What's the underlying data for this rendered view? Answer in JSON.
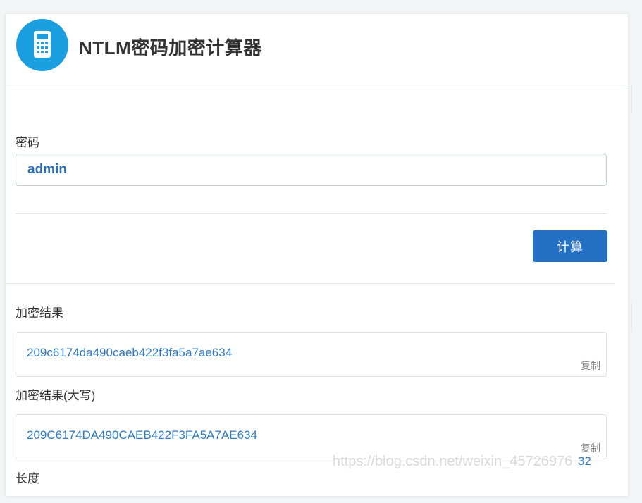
{
  "header": {
    "title": "NTLM密码加密计算器",
    "icon": "calculator-icon"
  },
  "password": {
    "label": "密码",
    "value": "admin"
  },
  "calc_button": {
    "label": "计算"
  },
  "result_lower": {
    "label": "加密结果",
    "value": "209c6174da490caeb422f3fa5a7ae634",
    "copy_label": "复制"
  },
  "result_upper": {
    "label": "加密结果(大写)",
    "value": "209C6174DA490CAEB422F3FA5A7AE634",
    "copy_label": "复制"
  },
  "length": {
    "label": "长度",
    "value": "32"
  },
  "watermark": "https://blog.csdn.net/weixin_45726976",
  "colors": {
    "accent": "#1a9fe0",
    "button": "#2470c4",
    "value_text": "#2f7bc6"
  }
}
